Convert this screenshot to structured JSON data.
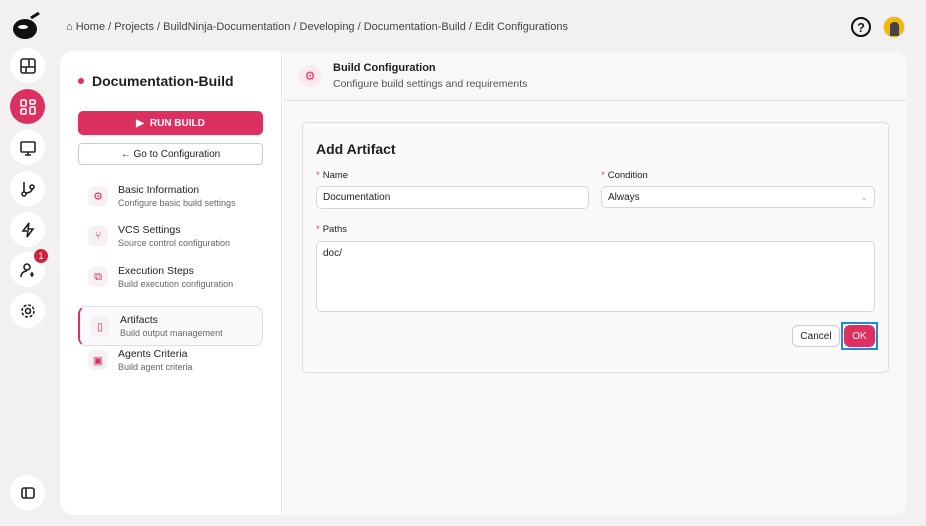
{
  "breadcrumb": [
    "Home",
    "Projects",
    "BuildNinja-Documentation",
    "Developing",
    "Documentation-Build",
    "Edit Configurations"
  ],
  "sidebar": {
    "notification_count": "1"
  },
  "project": {
    "title": "Documentation-Build",
    "run_build": "RUN BUILD",
    "go_to_config": "← Go to Configuration"
  },
  "nav": [
    {
      "title": "Basic Information",
      "subtitle": "Configure basic build settings",
      "icon": "gear-icon"
    },
    {
      "title": "VCS Settings",
      "subtitle": "Source control configuration",
      "icon": "branch-icon"
    },
    {
      "title": "Execution Steps",
      "subtitle": "Build execution configuration",
      "icon": "steps-icon"
    },
    {
      "title": "Artifacts",
      "subtitle": "Build output management",
      "icon": "file-icon"
    },
    {
      "title": "Agents Criteria",
      "subtitle": "Build agent criteria",
      "icon": "agent-icon"
    }
  ],
  "header": {
    "title": "Build Configuration",
    "subtitle": "Configure build settings and requirements"
  },
  "form": {
    "title": "Add Artifact",
    "name_label": "Name",
    "name_value": "Documentation",
    "condition_label": "Condition",
    "condition_value": "Always",
    "paths_label": "Paths",
    "paths_value": "doc/",
    "cancel": "Cancel",
    "ok": "OK"
  },
  "colors": {
    "accent": "#dc3060"
  }
}
